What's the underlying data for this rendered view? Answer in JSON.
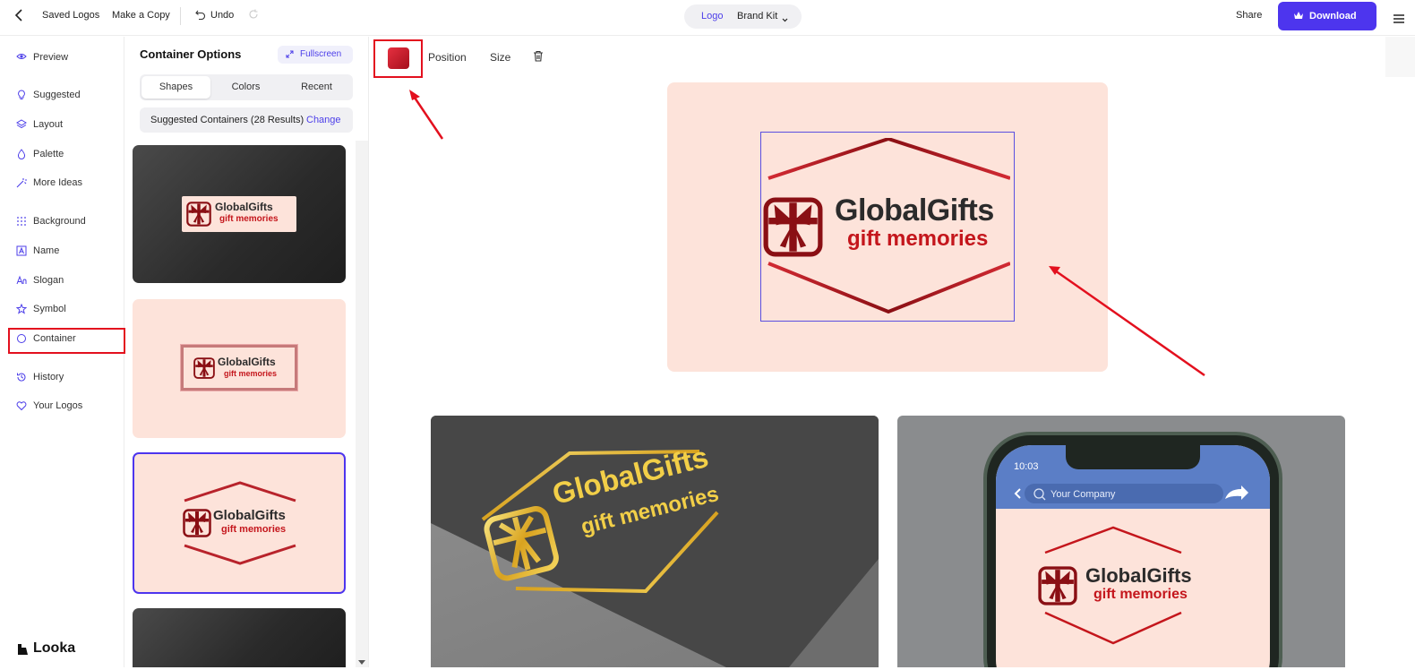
{
  "topbar": {
    "saved_logos": "Saved Logos",
    "make_copy": "Make a Copy",
    "undo": "Undo",
    "tab_logo": "Logo",
    "tab_brand_kit": "Brand Kit",
    "share": "Share",
    "download": "Download"
  },
  "nav": {
    "items": [
      {
        "label": "Preview",
        "icon": "eye-icon"
      },
      {
        "label": "Suggested",
        "icon": "lightbulb-icon"
      },
      {
        "label": "Layout",
        "icon": "layers-icon"
      },
      {
        "label": "Palette",
        "icon": "drop-icon"
      },
      {
        "label": "More Ideas",
        "icon": "wand-icon"
      },
      {
        "label": "Background",
        "icon": "grid-icon"
      },
      {
        "label": "Name",
        "icon": "text-box-icon"
      },
      {
        "label": "Slogan",
        "icon": "font-icon"
      },
      {
        "label": "Symbol",
        "icon": "star-icon"
      },
      {
        "label": "Container",
        "icon": "circle-icon"
      },
      {
        "label": "History",
        "icon": "history-icon"
      },
      {
        "label": "Your Logos",
        "icon": "heart-icon"
      }
    ],
    "brand": "Looka"
  },
  "panel": {
    "title": "Container Options",
    "fullscreen": "Fullscreen",
    "tabs": [
      "Shapes",
      "Colors",
      "Recent"
    ],
    "active_tab": "Shapes",
    "suggested_text": "Suggested Containers (28 Results)",
    "change": "Change"
  },
  "logo": {
    "name": "GlobalGifts",
    "slogan": "gift memories"
  },
  "toolbar": {
    "position": "Position",
    "size": "Size"
  },
  "phone": {
    "time": "10:03",
    "search_placeholder": "Your Company"
  },
  "colors": {
    "accent": "#4d35ee",
    "container_bg": "#fde3da",
    "logo_red": "#c4161c",
    "logo_dark": "#8a0f14",
    "name_dark": "#2b2b2b",
    "highlight": "#e3101e"
  }
}
